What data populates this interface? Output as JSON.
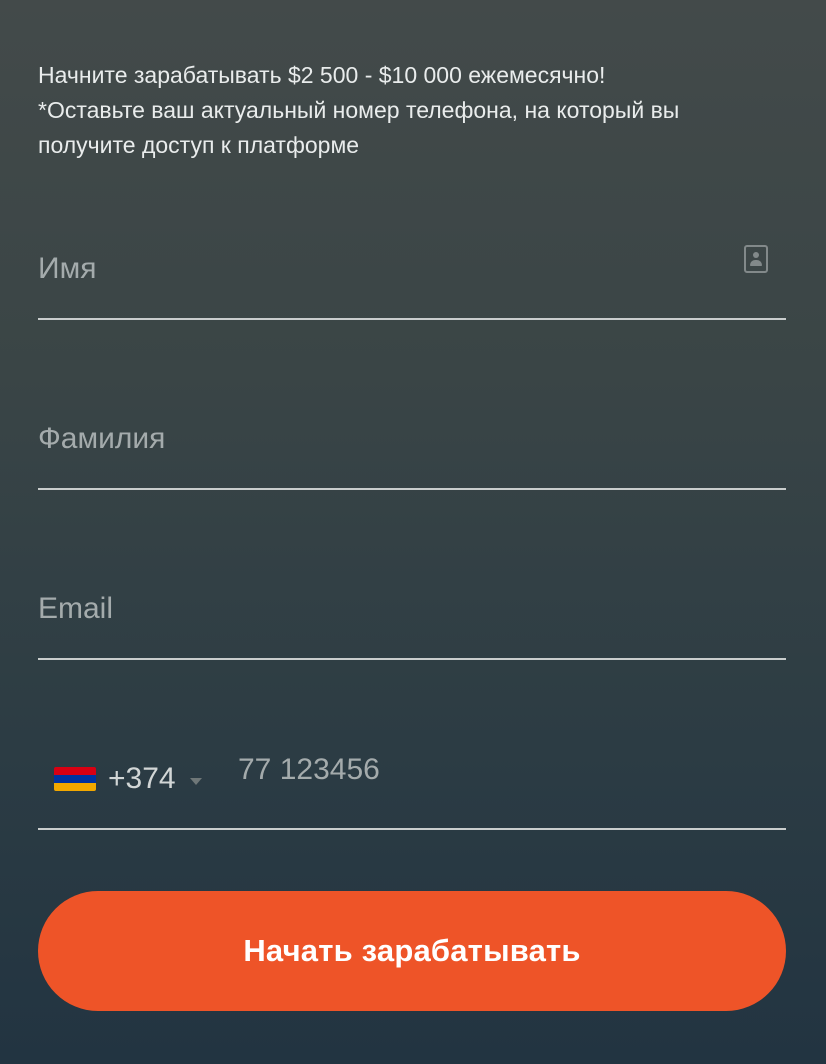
{
  "intro": {
    "line1": "Начните зарабатывать $2 500 - $10 000 ежемесячно!",
    "line2": "*Оставьте ваш актуальный номер телефона, на который вы получите доступ к платформе"
  },
  "form": {
    "first_name": {
      "placeholder": "Имя",
      "value": "",
      "icon": "contact-card-icon"
    },
    "last_name": {
      "placeholder": "Фамилия",
      "value": ""
    },
    "email": {
      "placeholder": "Email",
      "value": ""
    },
    "phone": {
      "country_flag": "armenia-flag-icon",
      "dial_code": "+374",
      "placeholder": "77 123456",
      "value": ""
    },
    "submit_label": "Начать зарабатывать"
  },
  "colors": {
    "accent": "#ee5428",
    "flag_armenia": [
      "#d90012",
      "#0033a0",
      "#f2a800"
    ]
  }
}
